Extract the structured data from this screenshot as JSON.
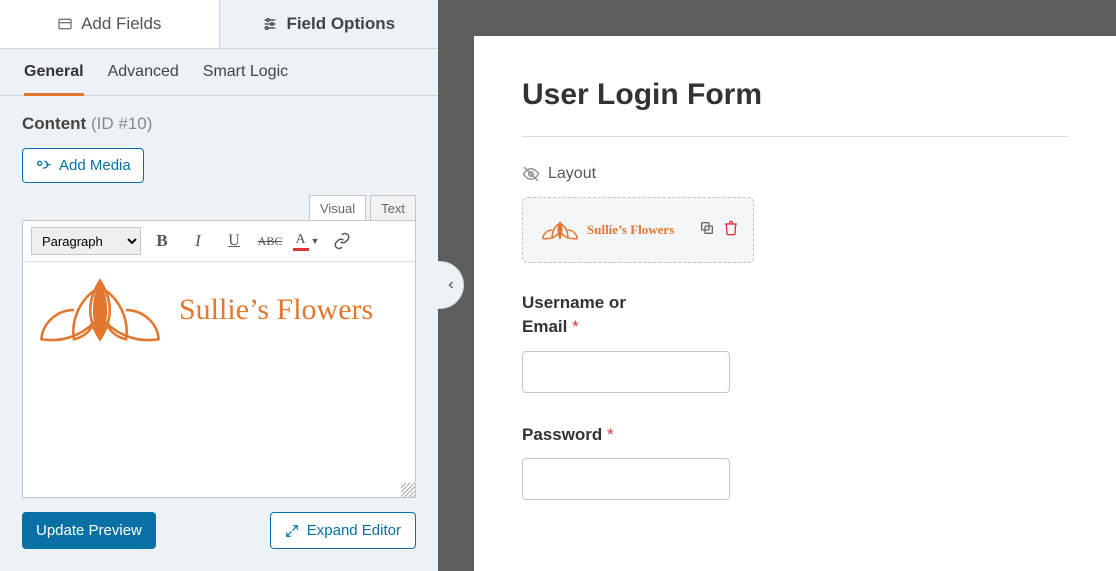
{
  "topTabs": {
    "addFields": "Add Fields",
    "fieldOptions": "Field Options"
  },
  "subTabs": {
    "general": "General",
    "advanced": "Advanced",
    "smartLogic": "Smart Logic"
  },
  "contentHeading": {
    "label": "Content",
    "id": "(ID #10)"
  },
  "addMedia": "Add Media",
  "editorTabs": {
    "visual": "Visual",
    "text": "Text"
  },
  "toolbar": {
    "paragraph": "Paragraph"
  },
  "brand": "Sullie’s Flowers",
  "buttons": {
    "updatePreview": "Update Preview",
    "expandEditor": "Expand Editor"
  },
  "form": {
    "title": "User Login Form",
    "layout": "Layout",
    "username": "Username or Email",
    "password": "Password",
    "required": "*"
  }
}
